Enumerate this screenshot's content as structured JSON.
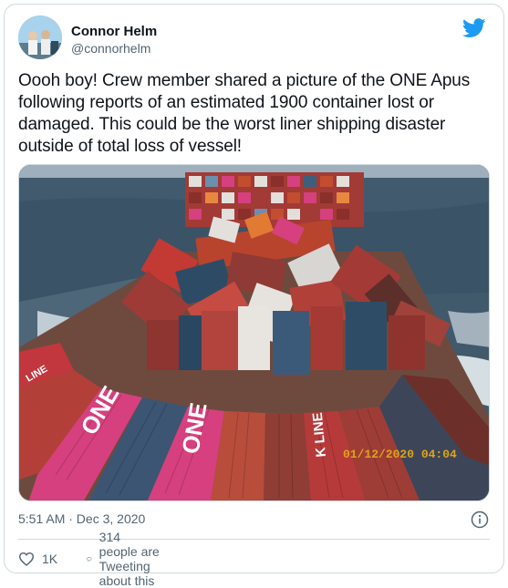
{
  "tweet": {
    "author_name": "Connor Helm",
    "author_handle": "@connorhelm",
    "text": "Oooh boy! Crew member shared a picture of the ONE Apus following reports of an estimated 1900 container lost or damaged. This could be the worst liner shipping disaster outside of total loss of vessel!",
    "timestamp": "5:51 AM · Dec 3, 2020",
    "like_count": "1K",
    "tweeting_text": "314 people are Tweeting about this"
  },
  "photo": {
    "container_labels": [
      "ONE",
      "ONE",
      "K LINE",
      "LINE"
    ],
    "photo_timestamp": "01/12/2020 04:04"
  },
  "icons": {
    "brand": "twitter-bird-icon",
    "info": "info-icon",
    "like": "heart-icon",
    "reply": "speech-bubble-icon"
  },
  "colors": {
    "twitter_blue": "#1d9bf0",
    "text_primary": "#0f1419",
    "text_secondary": "#536471",
    "border": "#cfd9de",
    "one_magenta": "#d6407e"
  }
}
